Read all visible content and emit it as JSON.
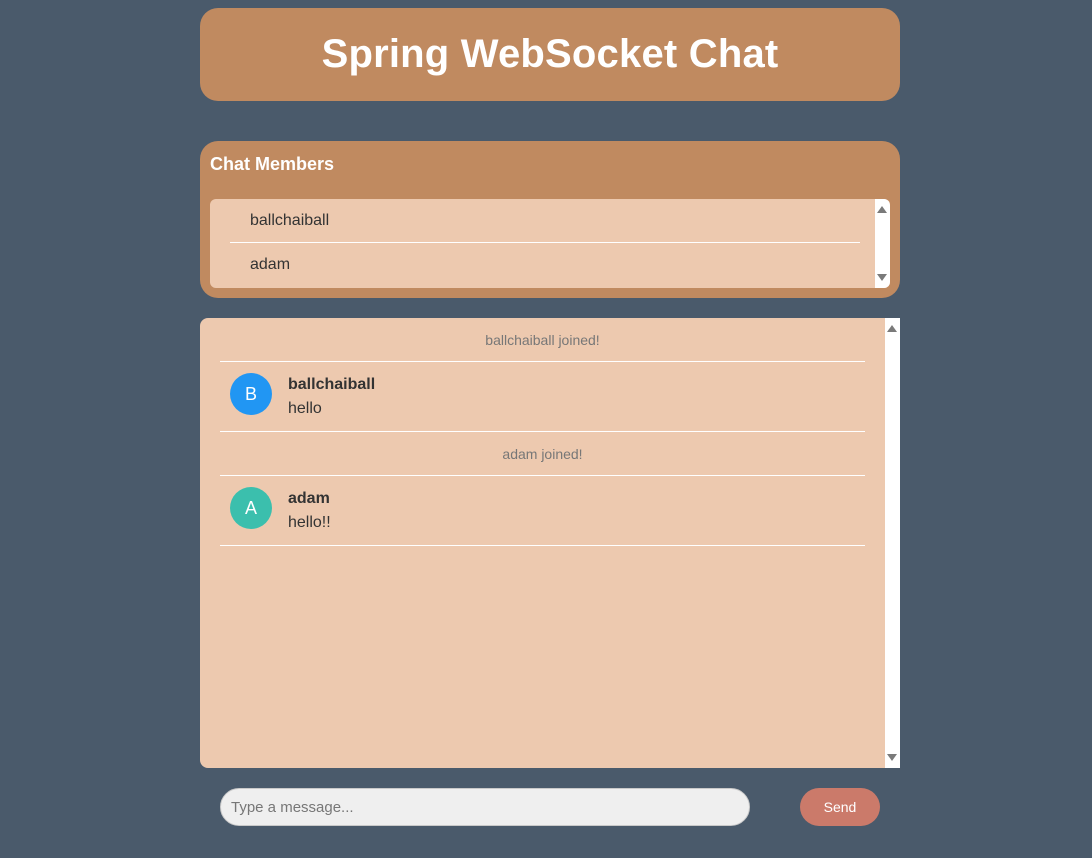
{
  "header": {
    "title": "Spring WebSocket Chat"
  },
  "members": {
    "title": "Chat Members",
    "items": [
      {
        "name": "ballchaiball"
      },
      {
        "name": "adam"
      }
    ]
  },
  "messages": [
    {
      "type": "event",
      "text": "ballchaiball joined!"
    },
    {
      "type": "chat",
      "initial": "B",
      "sender": "ballchaiball",
      "text": "hello",
      "avatar_color": "#2196f3"
    },
    {
      "type": "event",
      "text": "adam joined!"
    },
    {
      "type": "chat",
      "initial": "A",
      "sender": "adam",
      "text": "hello!!",
      "avatar_color": "#3bbfad"
    }
  ],
  "composer": {
    "placeholder": "Type a message...",
    "send_label": "Send"
  },
  "colors": {
    "background": "#4a5a6b",
    "panel": "#c08a60",
    "list_bg": "#edc9af",
    "send_button": "#cb7a6a"
  }
}
